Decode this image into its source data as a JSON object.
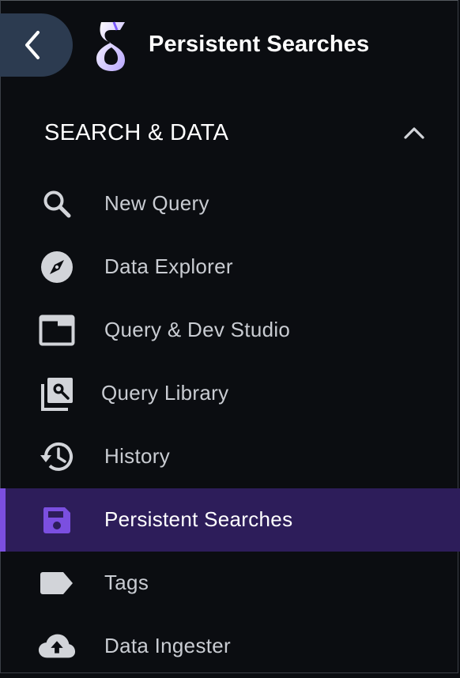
{
  "header": {
    "title": "Persistent Searches",
    "back_icon": "chevron-left-icon",
    "logo_icon": "app-logo-icon"
  },
  "section": {
    "title": "SEARCH & DATA",
    "expanded": true,
    "toggle_icon": "chevron-up-icon"
  },
  "nav": {
    "items": [
      {
        "label": "New Query",
        "icon": "search-icon",
        "active": false
      },
      {
        "label": "Data Explorer",
        "icon": "compass-icon",
        "active": false
      },
      {
        "label": "Query & Dev Studio",
        "icon": "window-icon",
        "active": false
      },
      {
        "label": "Query Library",
        "icon": "library-search-icon",
        "active": false
      },
      {
        "label": "History",
        "icon": "history-icon",
        "active": false
      },
      {
        "label": "Persistent Searches",
        "icon": "save-icon",
        "active": true
      },
      {
        "label": "Tags",
        "icon": "tag-icon",
        "active": false
      },
      {
        "label": "Data Ingester",
        "icon": "cloud-upload-icon",
        "active": false
      }
    ]
  },
  "colors": {
    "background": "#0b0d11",
    "back_button": "#2c3b50",
    "active_item_bg": "#2d1d5a",
    "active_accent": "#7b4fe0",
    "icon_default": "#d2d4d9"
  }
}
